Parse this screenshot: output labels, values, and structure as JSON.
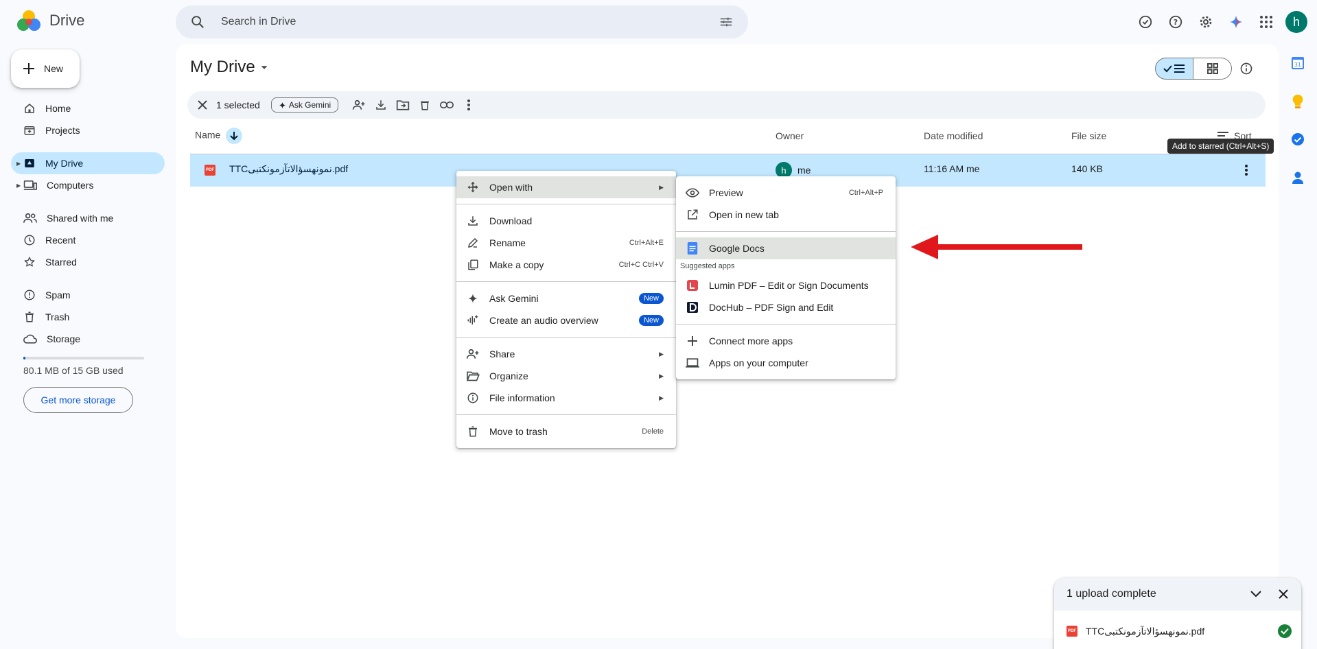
{
  "app": {
    "name": "Drive"
  },
  "search": {
    "placeholder": "Search in Drive"
  },
  "sidebar": {
    "new_label": "New",
    "items": [
      {
        "label": "Home"
      },
      {
        "label": "Projects"
      },
      {
        "label": "My Drive"
      },
      {
        "label": "Computers"
      },
      {
        "label": "Shared with me"
      },
      {
        "label": "Recent"
      },
      {
        "label": "Starred"
      },
      {
        "label": "Spam"
      },
      {
        "label": "Trash"
      },
      {
        "label": "Storage"
      }
    ],
    "storage_text": "80.1 MB of 15 GB used",
    "storage_fraction": 0.0053,
    "storage_button": "Get more storage"
  },
  "user": {
    "initial": "h"
  },
  "main": {
    "title": "My Drive",
    "selection": {
      "count_label": "1 selected",
      "gemini_label": "Ask Gemini"
    },
    "columns": {
      "name": "Name",
      "owner": "Owner",
      "date": "Date modified",
      "size": "File size",
      "sort": "Sort"
    },
    "file": {
      "name": "TTCنمونهسؤالاتآزمونکتبی.pdf",
      "type_label": "PDF",
      "owner_initial": "h",
      "owner": "me",
      "date": "11:16 AM me",
      "size": "140 KB"
    },
    "tooltip": "Add to starred (Ctrl+Alt+S)"
  },
  "context_menu": {
    "open_with": "Open with",
    "download": "Download",
    "rename": {
      "label": "Rename",
      "shortcut": "Ctrl+Alt+E"
    },
    "copy": {
      "label": "Make a copy",
      "shortcut": "Ctrl+C Ctrl+V"
    },
    "gemini": {
      "label": "Ask Gemini",
      "badge": "New"
    },
    "audio": {
      "label": "Create an audio overview",
      "badge": "New"
    },
    "share": "Share",
    "organize": "Organize",
    "info": "File information",
    "trash": {
      "label": "Move to trash",
      "shortcut": "Delete"
    }
  },
  "submenu": {
    "preview": {
      "label": "Preview",
      "shortcut": "Ctrl+Alt+P"
    },
    "new_tab": "Open in new tab",
    "docs": "Google Docs",
    "suggested_head": "Suggested apps",
    "lumin": "Lumin PDF – Edit or Sign Documents",
    "dochub": "DocHub – PDF Sign and Edit",
    "connect": "Connect more apps",
    "computer": "Apps on your computer"
  },
  "upload": {
    "title": "1 upload complete",
    "file_name": "TTCنمونهسؤالاتآزمونکتبی.pdf",
    "type_label": "PDF"
  },
  "rail": {
    "calendar_day": "31"
  },
  "colors": {
    "accent": "#0b57d0",
    "selected": "#c2e7ff",
    "arrow": "#e0181b"
  }
}
